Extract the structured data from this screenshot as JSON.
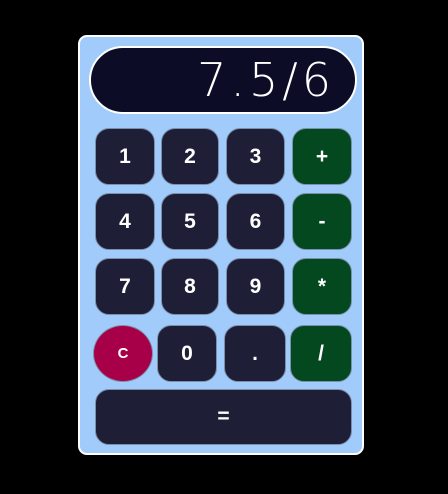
{
  "display": {
    "value": "7.5/6"
  },
  "keys": {
    "k1": "1",
    "k2": "2",
    "k3": "3",
    "plus": "+",
    "k4": "4",
    "k5": "5",
    "k6": "6",
    "minus": "-",
    "k7": "7",
    "k8": "8",
    "k9": "9",
    "multiply": "*",
    "clear": "C",
    "k0": "0",
    "dot": ".",
    "divide": "/",
    "equals": "="
  },
  "colors": {
    "body_background": "#a1cbfb",
    "display_background": "#0c0c27",
    "digit_key": "#1e1e36",
    "operator_key": "#03481f",
    "clear_key": "#a80048"
  }
}
